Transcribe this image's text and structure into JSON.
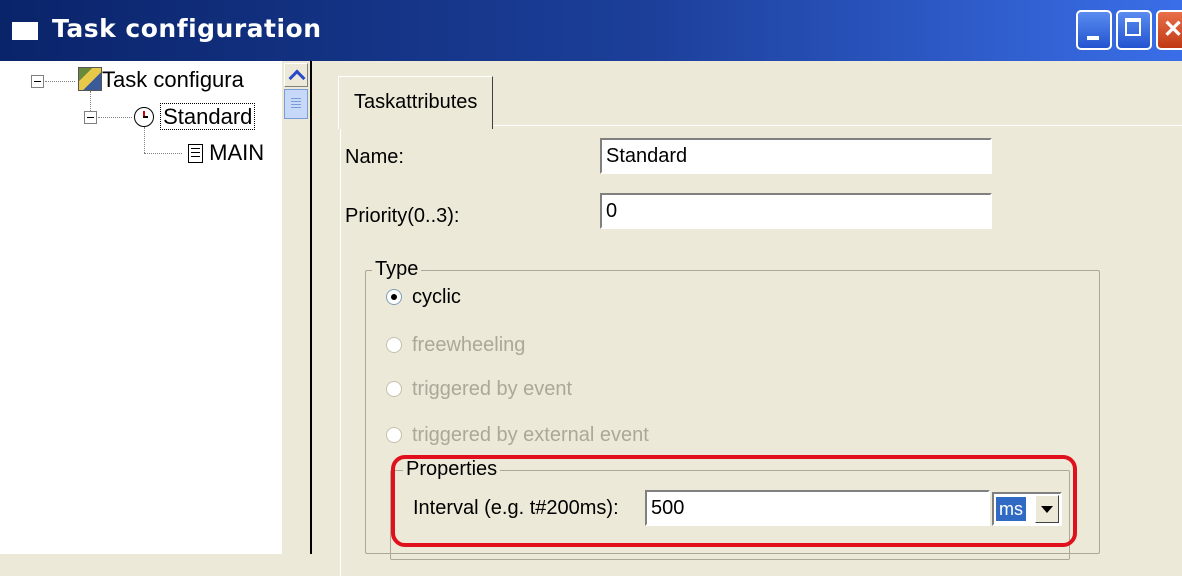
{
  "window": {
    "title": "Task configuration"
  },
  "tree": {
    "root_label": "Task configura",
    "task_label": "Standard",
    "program_label": "MAIN"
  },
  "tab": {
    "label": "Taskattributes"
  },
  "form": {
    "name_label": "Name:",
    "name_value": "Standard",
    "priority_label": "Priority(0..3):",
    "priority_value": "0"
  },
  "type_group": {
    "title": "Type",
    "options": [
      {
        "label": "cyclic",
        "selected": true,
        "enabled": true
      },
      {
        "label": "freewheeling",
        "selected": false,
        "enabled": false
      },
      {
        "label": "triggered by event",
        "selected": false,
        "enabled": false
      },
      {
        "label": "triggered by external event",
        "selected": false,
        "enabled": false
      }
    ]
  },
  "properties": {
    "title": "Properties",
    "interval_label": "Interval (e.g. t#200ms):",
    "interval_value": "500",
    "unit_value": "ms"
  },
  "colors": {
    "highlight": "#e0101c",
    "selection": "#316ac5"
  }
}
